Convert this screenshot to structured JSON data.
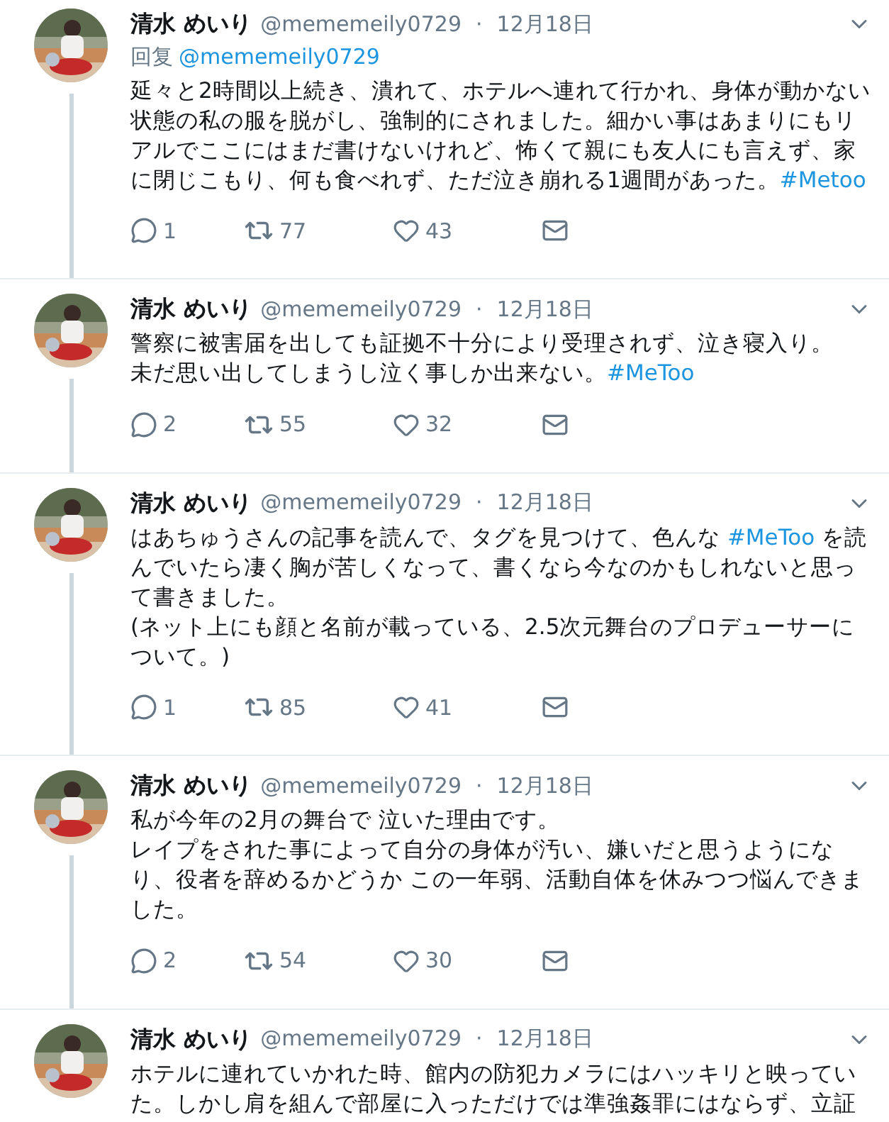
{
  "tweets": [
    {
      "name": "清水 めいり",
      "handle": "@mememeily0729",
      "separator": "·",
      "date": "12月18日",
      "reply": {
        "label": "回复",
        "handle": "@mememeily0729"
      },
      "paragraphs": [
        [
          {
            "kind": "text",
            "text": "延々と2時間以上続き、潰れて、ホテルへ連れて行かれ、身体が動かない状態の私の服を脱がし、強制的にされました。細かい事はあまりにもリアルでここにはまだ書けないけれど、怖くて親にも友人にも言えず、家に閉じこもり、何も食べれず、ただ泣き崩れる1週間があった。"
          },
          {
            "kind": "hashtag",
            "text": "#Metoo"
          }
        ]
      ],
      "replies": "1",
      "retweets": "77",
      "likes": "43"
    },
    {
      "name": "清水 めいり",
      "handle": "@mememeily0729",
      "separator": "·",
      "date": "12月18日",
      "paragraphs": [
        [
          {
            "kind": "text",
            "text": "警察に被害届を出しても証拠不十分により受理されず、泣き寝入り。"
          }
        ],
        [
          {
            "kind": "text",
            "text": "未だ思い出してしまうし泣く事しか出来ない。"
          },
          {
            "kind": "hashtag",
            "text": "#MeToo"
          }
        ]
      ],
      "replies": "2",
      "retweets": "55",
      "likes": "32"
    },
    {
      "name": "清水 めいり",
      "handle": "@mememeily0729",
      "separator": "·",
      "date": "12月18日",
      "paragraphs": [
        [
          {
            "kind": "text",
            "text": "はあちゅうさんの記事を読んで、タグを見つけて、色んな "
          },
          {
            "kind": "hashtag",
            "text": "#MeToo"
          },
          {
            "kind": "text",
            "text": " を読んでいたら凄く胸が苦しくなって、書くなら今なのかもしれないと思って書きました。"
          }
        ],
        [
          {
            "kind": "text",
            "text": "(ネット上にも顔と名前が載っている、2.5次元舞台のプロデューサーについて。)"
          }
        ]
      ],
      "replies": "1",
      "retweets": "85",
      "likes": "41"
    },
    {
      "name": "清水 めいり",
      "handle": "@mememeily0729",
      "separator": "·",
      "date": "12月18日",
      "paragraphs": [
        [
          {
            "kind": "text",
            "text": "私が今年の2月の舞台で 泣いた理由です。"
          }
        ],
        [
          {
            "kind": "text",
            "text": "レイプをされた事によって自分の身体が汚い、嫌いだと思うようになり、役者を辞めるかどうか この一年弱、活動自体を休みつつ悩んできました。"
          }
        ]
      ],
      "replies": "2",
      "retweets": "54",
      "likes": "30"
    },
    {
      "name": "清水 めいり",
      "handle": "@mememeily0729",
      "separator": "·",
      "date": "12月18日",
      "paragraphs": [
        [
          {
            "kind": "text",
            "text": "ホテルに連れていかれた時、館内の防犯カメラにはハッキリと映っていた。しかし肩を組んで部屋に入っただけでは準強姦罪にはならず、立証"
          }
        ]
      ]
    }
  ]
}
